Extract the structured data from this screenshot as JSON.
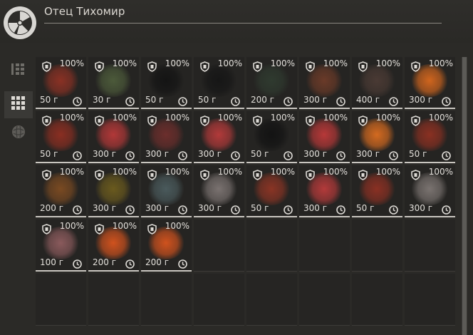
{
  "header": {
    "title": "Отец Тихомир",
    "logo_icon": "radiation-icon"
  },
  "sidebar": {
    "items": [
      {
        "name": "list-view-tab",
        "icon": "list-icon",
        "active": false
      },
      {
        "name": "grid-view-tab",
        "icon": "grid-icon",
        "active": true
      },
      {
        "name": "artifact-tab",
        "icon": "sphere-icon",
        "active": false
      }
    ]
  },
  "grid": {
    "columns": 8,
    "rows_total": 5,
    "items": [
      {
        "pct": "100%",
        "price": "50 г",
        "color": "#8a3124"
      },
      {
        "pct": "100%",
        "price": "30 г",
        "color": "#4c5a3a"
      },
      {
        "pct": "100%",
        "price": "50 г",
        "color": "#141414"
      },
      {
        "pct": "100%",
        "price": "50 г",
        "color": "#161616"
      },
      {
        "pct": "100%",
        "price": "200 г",
        "color": "#2f3a2f"
      },
      {
        "pct": "100%",
        "price": "300 г",
        "color": "#6a3a28"
      },
      {
        "pct": "100%",
        "price": "400 г",
        "color": "#4a3a34"
      },
      {
        "pct": "100%",
        "price": "300 г",
        "color": "#d0651e"
      },
      {
        "pct": "100%",
        "price": "50 г",
        "color": "#8a2e22"
      },
      {
        "pct": "100%",
        "price": "300 г",
        "color": "#b23838"
      },
      {
        "pct": "100%",
        "price": "300 г",
        "color": "#6c2e2c"
      },
      {
        "pct": "100%",
        "price": "300 г",
        "color": "#b23a3a"
      },
      {
        "pct": "100%",
        "price": "50 г",
        "color": "#131313"
      },
      {
        "pct": "100%",
        "price": "300 г",
        "color": "#b73838"
      },
      {
        "pct": "100%",
        "price": "300 г",
        "color": "#d46a20"
      },
      {
        "pct": "100%",
        "price": "50 г",
        "color": "#8a3022"
      },
      {
        "pct": "100%",
        "price": "200 г",
        "color": "#7a4a22"
      },
      {
        "pct": "100%",
        "price": "300 г",
        "color": "#6a5a1e"
      },
      {
        "pct": "100%",
        "price": "300 г",
        "color": "#4a5a5c"
      },
      {
        "pct": "100%",
        "price": "300 г",
        "color": "#7a7270"
      },
      {
        "pct": "100%",
        "price": "50 г",
        "color": "#8a3424"
      },
      {
        "pct": "100%",
        "price": "300 г",
        "color": "#b33a3a"
      },
      {
        "pct": "100%",
        "price": "50 г",
        "color": "#8a3023"
      },
      {
        "pct": "100%",
        "price": "300 г",
        "color": "#7a7370"
      },
      {
        "pct": "100%",
        "price": "100 г",
        "color": "#8a5a5c"
      },
      {
        "pct": "100%",
        "price": "200 г",
        "color": "#d0521e"
      },
      {
        "pct": "100%",
        "price": "200 г",
        "color": "#d0521e"
      }
    ]
  },
  "colors": {
    "accent": "#c9c6c0",
    "background": "#2b2a27"
  }
}
